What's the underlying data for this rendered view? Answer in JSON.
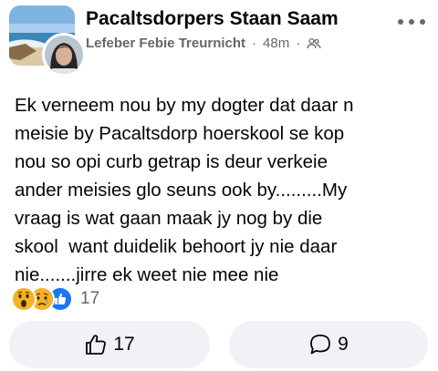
{
  "post": {
    "group_name": "Pacaltsdorpers Staan Saam",
    "author": "Lefeber Febie Treurnicht",
    "separator": "·",
    "time": "48m",
    "privacy_icon": "group-members-icon",
    "text_lines": [
      "Ek verneem nou by my dogter dat daar n",
      "meisie by Pacaltsdorp hoerskool se kop",
      "nou so opi curb getrap is deur verkeie",
      "ander meisies glo seuns ook by.........My",
      "vraag is wat gaan maak jy nog by die",
      "skool  want duidelik behoort jy nie daar",
      "nie.......jirre ek weet nie mee nie"
    ]
  },
  "reactions": {
    "icons": [
      "wow-reaction-icon",
      "sad-reaction-icon",
      "like-reaction-icon"
    ],
    "count": "17"
  },
  "actions": {
    "like_count": "17",
    "comment_count": "9"
  },
  "colors": {
    "secondary_text": "#65676b",
    "button_bg": "#f0f2f5",
    "like_blue": "#1877f2",
    "reaction_yellow": "#f7b125"
  }
}
